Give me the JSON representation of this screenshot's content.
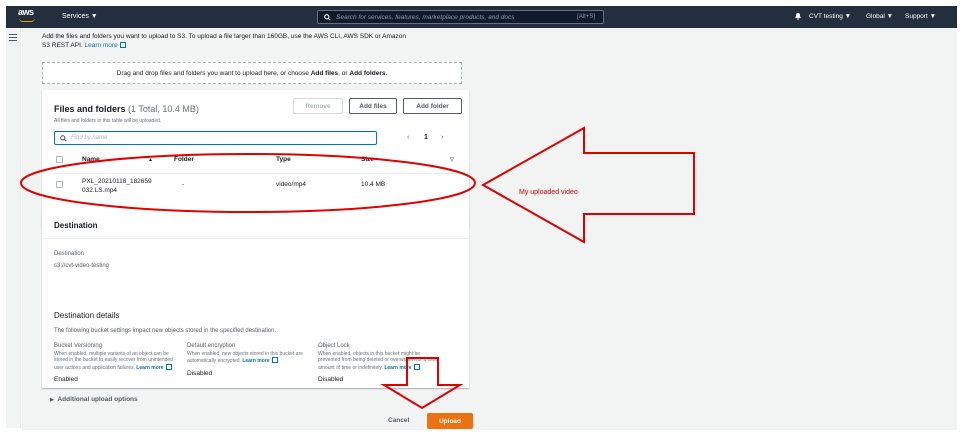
{
  "topnav": {
    "logo_text": "aws",
    "services_label": "Services ▼",
    "search_placeholder": "Search for services, features, marketplace products, and docs",
    "search_shortcut": "[Alt+S]",
    "account_label": "CVT testing ▼",
    "region_label": "Global ▼",
    "support_label": "Support ▼"
  },
  "intro": {
    "text_line1": "Add the files and folders you want to upload to S3. To upload a file larger than 160GB, use the AWS CLI, AWS SDK or Amazon",
    "text_line2": "S3 REST API.",
    "learn_more": "Learn more"
  },
  "dropzone": {
    "text_prefix": "Drag and drop files and folders you want to upload here, or choose ",
    "add_files_bold": "Add files",
    "or_text": ", or ",
    "add_folders_bold": "Add folders",
    "period": "."
  },
  "files_panel": {
    "title": "Files and folders",
    "count": "(1 Total, 10.4 MB)",
    "subtitle": "All files and folders in this table will be uploaded.",
    "remove_label": "Remove",
    "add_files_label": "Add files",
    "add_folder_label": "Add folder",
    "filter_placeholder": "Find by name",
    "page_number": "1",
    "columns": [
      "Name",
      "Folder",
      "Type",
      "Size"
    ],
    "rows": [
      {
        "name_line1": "PXL_20210118_182659",
        "name_line2": "032.LS.mp4",
        "folder": "-",
        "type": "video/mp4",
        "size": "10.4 MB"
      }
    ]
  },
  "destination": {
    "header": "Destination",
    "label": "Destination",
    "bucket_link": "s3://cvt-video-testing",
    "details_title": "Destination details",
    "details_desc": "The following bucket settings impact new objects stored in the specified destination.",
    "settings": [
      {
        "name": "Bucket Versioning",
        "desc": "When enabled, multiple variants of an object can be stored in the bucket to easily recover from unintended user actions and application failures.",
        "link": "Learn more",
        "value": "Enabled"
      },
      {
        "name": "Default encryption",
        "desc": "When enabled, new objects stored in this bucket are automatically encrypted.",
        "link": "Learn more",
        "value": "Disabled"
      },
      {
        "name": "Object Lock",
        "desc": "When enabled, objects in this bucket might be prevented from being deleted or overwritten for a fixed amount of time or indefinitely.",
        "link": "Learn more",
        "value": "Disabled"
      }
    ]
  },
  "footer": {
    "additional_options": "Additional upload options",
    "cancel_label": "Cancel",
    "upload_label": "Upload"
  },
  "annotation": {
    "text": "My uploaded video",
    "color": "#e00000"
  },
  "colors": {
    "nav_bg": "#232f3e",
    "link": "#0073bb",
    "primary_button": "#ec7211"
  }
}
